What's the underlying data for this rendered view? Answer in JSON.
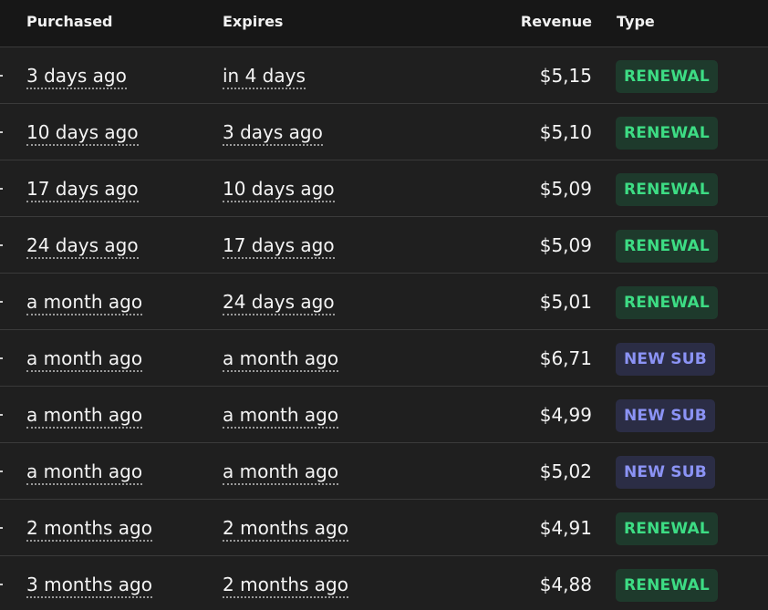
{
  "header": {
    "purchased": "Purchased",
    "expires": "Expires",
    "revenue": "Revenue",
    "type": "Type"
  },
  "colors": {
    "renewal_text": "#3ddc84",
    "renewal_bg": "#1e3a2c",
    "newsub_text": "#8b93f5",
    "newsub_bg": "#2b2d45"
  },
  "rows": [
    {
      "purchased": "3 days ago",
      "expires": "in 4 days",
      "revenue": "$5,15",
      "type": "RENEWAL",
      "kind": "renewal"
    },
    {
      "purchased": "10 days ago",
      "expires": "3 days ago",
      "revenue": "$5,10",
      "type": "RENEWAL",
      "kind": "renewal"
    },
    {
      "purchased": "17 days ago",
      "expires": "10 days ago",
      "revenue": "$5,09",
      "type": "RENEWAL",
      "kind": "renewal"
    },
    {
      "purchased": "24 days ago",
      "expires": "17 days ago",
      "revenue": "$5,09",
      "type": "RENEWAL",
      "kind": "renewal"
    },
    {
      "purchased": "a month ago",
      "expires": "24 days ago",
      "revenue": "$5,01",
      "type": "RENEWAL",
      "kind": "renewal"
    },
    {
      "purchased": "a month ago",
      "expires": "a month ago",
      "revenue": "$6,71",
      "type": "NEW SUB",
      "kind": "newsub"
    },
    {
      "purchased": "a month ago",
      "expires": "a month ago",
      "revenue": "$4,99",
      "type": "NEW SUB",
      "kind": "newsub"
    },
    {
      "purchased": "a month ago",
      "expires": "a month ago",
      "revenue": "$5,02",
      "type": "NEW SUB",
      "kind": "newsub"
    },
    {
      "purchased": "2 months ago",
      "expires": "2 months ago",
      "revenue": "$4,91",
      "type": "RENEWAL",
      "kind": "renewal"
    },
    {
      "purchased": "3 months ago",
      "expires": "2 months ago",
      "revenue": "$4,88",
      "type": "RENEWAL",
      "kind": "renewal"
    }
  ]
}
